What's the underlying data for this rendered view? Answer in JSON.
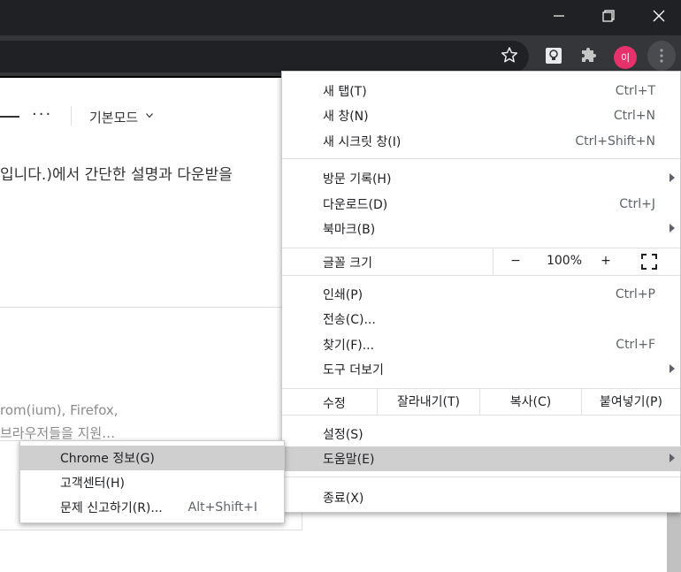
{
  "window": {
    "minimize_icon": "minimize-icon",
    "maximize_icon": "restore-icon",
    "close_icon": "close-icon"
  },
  "toolbar": {
    "avatar_letter": "이",
    "accent_avatar": "#e7316a"
  },
  "page": {
    "mode_label": "기본모드",
    "dots": "···",
    "line1": "입니다.)에서 간단한 설명과 다운받을",
    "snippet1": "rom(ium), Firefox,",
    "snippet2": "브라우저들을 지원…"
  },
  "menu": {
    "new_tab": {
      "label": "새 탭(T)",
      "shortcut": "Ctrl+T"
    },
    "new_window": {
      "label": "새 창(N)",
      "shortcut": "Ctrl+N"
    },
    "incognito": {
      "label": "새 시크릿 창(I)",
      "shortcut": "Ctrl+Shift+N"
    },
    "history": {
      "label": "방문 기록(H)"
    },
    "downloads": {
      "label": "다운로드(D)",
      "shortcut": "Ctrl+J"
    },
    "bookmarks": {
      "label": "북마크(B)"
    },
    "zoom": {
      "label": "글꼴 크기",
      "minus": "−",
      "value": "100%",
      "plus": "+"
    },
    "print": {
      "label": "인쇄(P)",
      "shortcut": "Ctrl+P"
    },
    "cast": {
      "label": "전송(C)..."
    },
    "find": {
      "label": "찾기(F)...",
      "shortcut": "Ctrl+F"
    },
    "more_tools": {
      "label": "도구 더보기"
    },
    "edit": {
      "label": "수정",
      "cut": "잘라내기(T)",
      "copy": "복사(C)",
      "paste": "붙여넣기(P)"
    },
    "settings": {
      "label": "설정(S)"
    },
    "help": {
      "label": "도움말(E)"
    },
    "exit": {
      "label": "종료(X)"
    }
  },
  "help_submenu": {
    "about": {
      "label": "Chrome 정보(G)"
    },
    "help_center": {
      "label": "고객센터(H)"
    },
    "report": {
      "label": "문제 신고하기(R)...",
      "shortcut": "Alt+Shift+I"
    }
  }
}
